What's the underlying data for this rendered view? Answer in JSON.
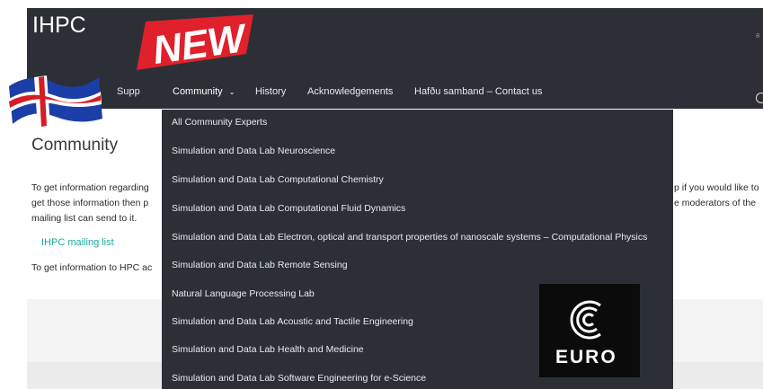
{
  "header": {
    "brand": "IHPC",
    "rss_icon": "rss-icon",
    "search_icon": "search-icon"
  },
  "badge": {
    "text": "NEW",
    "color": "#e0202a"
  },
  "nav": {
    "items": [
      {
        "label": "Supp"
      },
      {
        "label": "Community"
      },
      {
        "label": "History"
      },
      {
        "label": "Acknowledgements"
      },
      {
        "label": "Hafðu samband – Contact us"
      }
    ]
  },
  "dropdown": {
    "items": [
      "All Community Experts",
      "Simulation and Data Lab Neuroscience",
      "Simulation and Data Lab Computational Chemistry",
      "Simulation and Data Lab Computational Fluid Dynamics",
      "Simulation and Data Lab Electron, optical and transport properties of nanoscale systems – Computational Physics",
      "Simulation and Data Lab Remote Sensing",
      "Natural Language Processing Lab",
      "Simulation and Data Lab Acoustic and Tactile Engineering",
      "Simulation and Data Lab Health and Medicine",
      "Simulation and Data Lab Software Engineering for e-Science"
    ]
  },
  "page": {
    "title": "Community",
    "para1_left_1": "To get information regarding",
    "para1_left_2": "get those information then p",
    "para1_left_3": "mailing list can send to it.",
    "para1_right_1": "p if you would like to",
    "para1_right_2": "e moderators of the",
    "mailing_list_link": "IHPC mailing list",
    "para2": "To get information to HPC ac"
  },
  "euro_logo": {
    "text": "EURO"
  },
  "colors": {
    "header_bg": "#2c3036",
    "link": "#1aa89c"
  }
}
